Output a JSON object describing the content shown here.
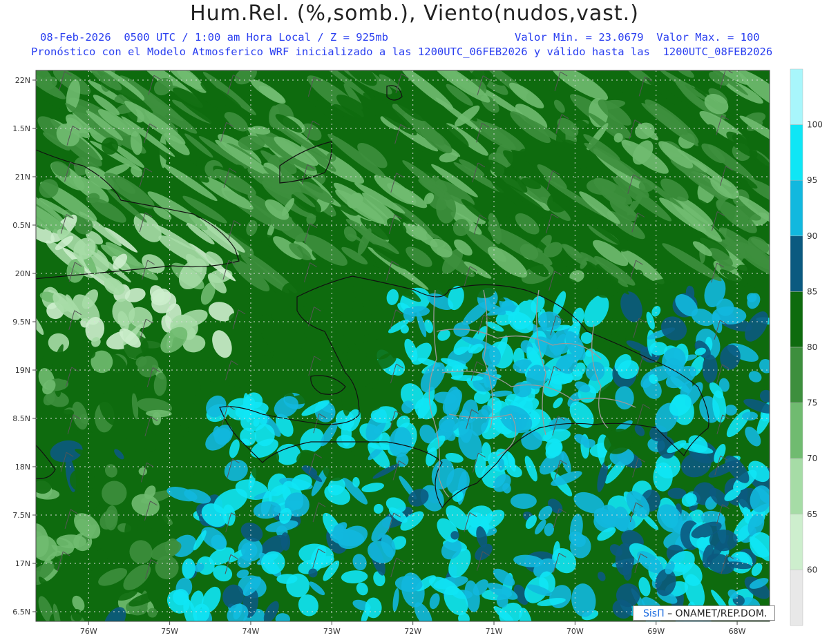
{
  "header": {
    "title": "Hum.Rel. (%,somb.), Viento(nudos,vast.)",
    "line1_left": "08-Feb-2026  0500 UTC / 1:00 am Hora Local / Z = 925mb",
    "line1_right": "Valor Min. = 23.0679  Valor Max. = 100",
    "line2": "Pronóstico con el Modelo Atmosferico WRF inicializado a las 1200UTC_06FEB2026 y válido hasta las  1200UTC_08FEB2026"
  },
  "credit": {
    "brand": "SisΠ",
    "text": "– ONAMET/REP.DOM."
  },
  "axes": {
    "lat_labels": [
      "22N",
      "1.5N",
      "21N",
      "0.5N",
      "20N",
      "9.5N",
      "19N",
      "8.5N",
      "18N",
      "7.5N",
      "17N",
      "6.5N"
    ],
    "lon_labels": [
      "76W",
      "75W",
      "74W",
      "73W",
      "72W",
      "71W",
      "70W",
      "69W",
      "68W"
    ],
    "lat_values": [
      22,
      21.5,
      21,
      20.5,
      20,
      19.5,
      19,
      18.5,
      18,
      17.5,
      17,
      16.5
    ],
    "lon_values": [
      -76,
      -75,
      -74,
      -73,
      -72,
      -71,
      -70,
      -69,
      -68
    ],
    "lon_range": [
      -76.65,
      -67.6
    ],
    "lat_range": [
      16.4,
      22.1
    ]
  },
  "colorbar": {
    "labels": [
      "100",
      "95",
      "90",
      "85",
      "80",
      "75",
      "70",
      "65",
      "60"
    ],
    "levels": [
      60,
      65,
      70,
      75,
      80,
      85,
      90,
      95,
      100
    ],
    "colors": [
      "#e8e8e8",
      "#cdeecd",
      "#a6dca6",
      "#70bb70",
      "#3d8f3d",
      "#0e6b0e",
      "#0b5a80",
      "#12b8de",
      "#0fe6f5",
      "#a8f6fb"
    ]
  }
}
